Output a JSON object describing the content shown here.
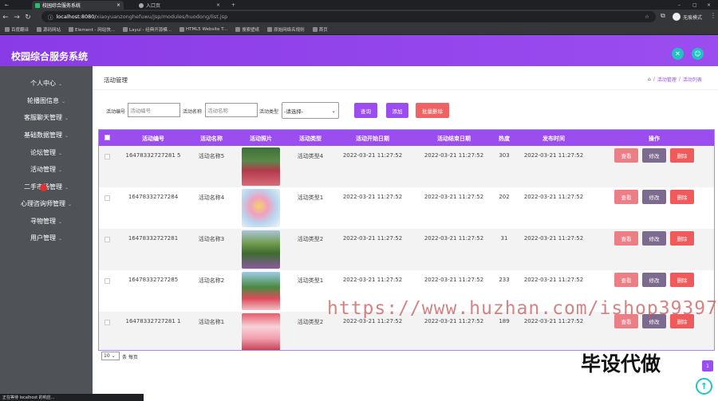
{
  "browser": {
    "tabs": [
      {
        "title": "校园综合服务系统"
      },
      {
        "title": "入口页"
      }
    ],
    "url_host": "localhost:8080/",
    "url_path": "xiaoyuanzonghefuwu/jsp/modules/huodong/list.jsp",
    "profile_label": "无痕模式",
    "bookmarks": [
      "百度翻译",
      "源码网站",
      "Element - 网站快...",
      "Layui - 经典开源模...",
      "HTML5 Website T...",
      "搜索壁纸",
      "原始网络名规则",
      "首页"
    ],
    "status_text": "正在等待 localhost 的响应..."
  },
  "app": {
    "title": "校园综合服务系统",
    "colors": {
      "primary": "#9b4df0",
      "accent": "#21c2c0"
    },
    "header_icons": [
      "close-icon",
      "user-icon"
    ]
  },
  "sidebar": {
    "items": [
      {
        "label": "个人中心"
      },
      {
        "label": "轮播图信息"
      },
      {
        "label": "客服聊天管理"
      },
      {
        "label": "基础数据管理"
      },
      {
        "label": "论坛管理"
      },
      {
        "label": "活动管理"
      },
      {
        "label": "二手市场管理"
      },
      {
        "label": "心理咨询师管理"
      },
      {
        "label": "寻物管理"
      },
      {
        "label": "用户管理"
      }
    ]
  },
  "page": {
    "title": "活动管理",
    "breadcrumb": {
      "home_icon": "home-icon",
      "sep": "/",
      "items": [
        "活动管理",
        "活动列表"
      ]
    },
    "search": {
      "field1_label": "活动编号",
      "field1_placeholder": "活动编号",
      "field2_label": "活动名称",
      "field2_placeholder": "活动名称",
      "field3_label": "活动类型",
      "field3_value": "-请选择-"
    },
    "buttons": {
      "query": "查询",
      "add": "添加",
      "batch_delete": "批量删除"
    },
    "table": {
      "headers": [
        "活动编号",
        "活动名称",
        "活动照片",
        "活动类型",
        "活动开始日期",
        "活动结束日期",
        "热度",
        "发布时间",
        "操作"
      ],
      "rows": [
        {
          "id": "16478332727281 5",
          "name": "活动名称5",
          "type": "活动类型4",
          "start": "2022-03-21 11:27:52",
          "end": "2022-03-21 11:27:52",
          "heat": "303",
          "published": "2022-03-21 11:27:52"
        },
        {
          "id": "16478332727284",
          "name": "活动名称4",
          "type": "活动类型1",
          "start": "2022-03-21 11:27:52",
          "end": "2022-03-21 11:27:52",
          "heat": "202",
          "published": "2022-03-21 11:27:52"
        },
        {
          "id": "16478332727281",
          "name": "活动名称3",
          "type": "活动类型2",
          "start": "2022-03-21 11:27:52",
          "end": "2022-03-21 11:27:52",
          "heat": "31",
          "published": "2022-03-21 11:27:52"
        },
        {
          "id": "16478332727285",
          "name": "活动名称2",
          "type": "活动类型1",
          "start": "2022-03-21 11:27:52",
          "end": "2022-03-21 11:27:52",
          "heat": "233",
          "published": "2022-03-21 11:27:52"
        },
        {
          "id": "16478332727281 1",
          "name": "活动名称1",
          "type": "活动类型2",
          "start": "2022-03-21 11:27:52",
          "end": "2022-03-21 11:27:52",
          "heat": "189",
          "published": "2022-03-21 11:27:52"
        }
      ],
      "actions": {
        "view": "查看",
        "edit": "修改",
        "delete": "删除"
      }
    },
    "pagination": {
      "page_size": "10",
      "per_page_label": "条 每页",
      "current_page": "1"
    }
  },
  "overlays": {
    "watermark_url": "https://www.huzhan.com/ishop39397",
    "watermark_text": "毕设代做"
  }
}
